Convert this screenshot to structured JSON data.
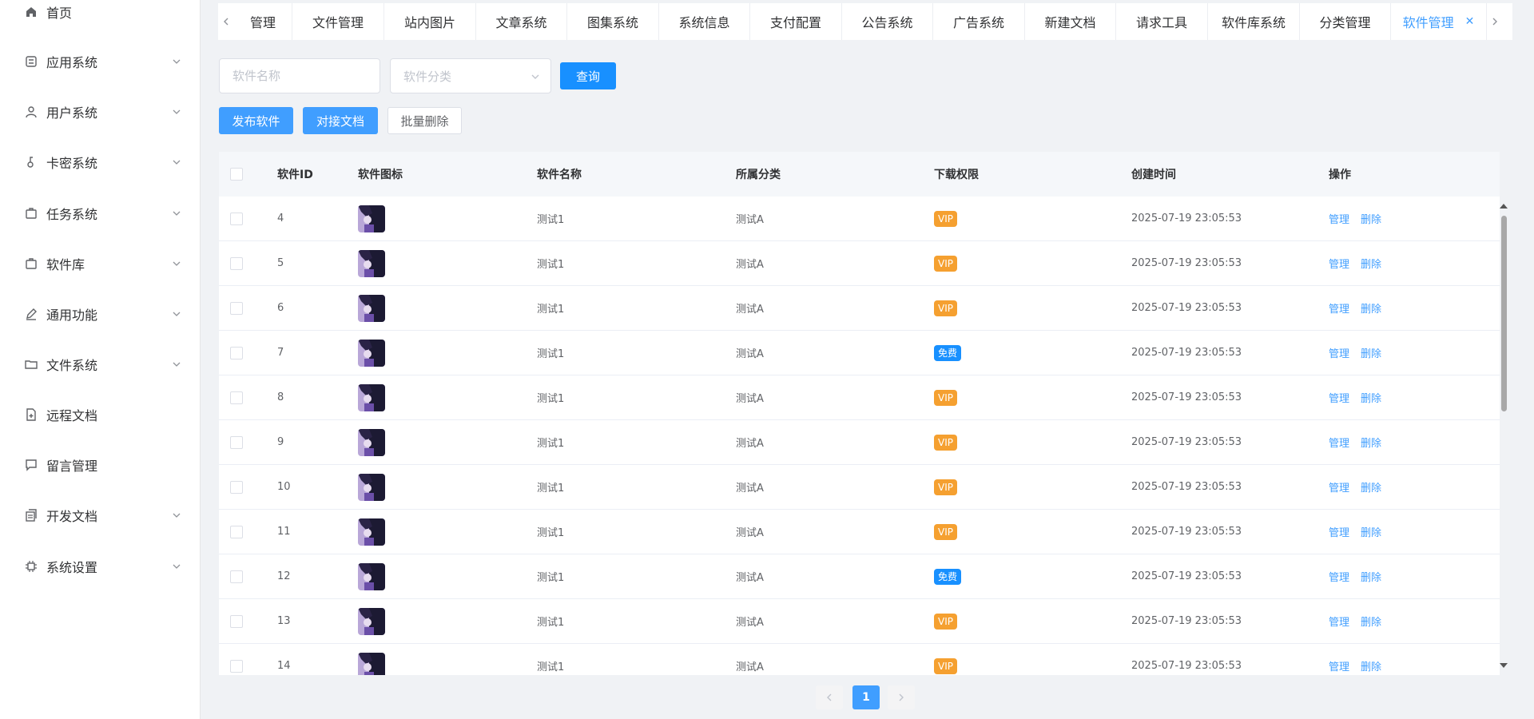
{
  "sidebar": {
    "items": [
      {
        "label": "首页",
        "icon": "home-icon",
        "expandable": false
      },
      {
        "label": "应用系统",
        "icon": "app-icon",
        "expandable": true
      },
      {
        "label": "用户系统",
        "icon": "user-icon",
        "expandable": true
      },
      {
        "label": "卡密系统",
        "icon": "key-icon",
        "expandable": true
      },
      {
        "label": "任务系统",
        "icon": "task-icon",
        "expandable": true
      },
      {
        "label": "软件库",
        "icon": "software-icon",
        "expandable": true
      },
      {
        "label": "通用功能",
        "icon": "edit-icon",
        "expandable": true
      },
      {
        "label": "文件系统",
        "icon": "folder-icon",
        "expandable": true
      },
      {
        "label": "远程文档",
        "icon": "remote-doc-icon",
        "expandable": false
      },
      {
        "label": "留言管理",
        "icon": "message-icon",
        "expandable": false
      },
      {
        "label": "开发文档",
        "icon": "dev-doc-icon",
        "expandable": true
      },
      {
        "label": "系统设置",
        "icon": "chip-icon",
        "expandable": true
      }
    ]
  },
  "tabs": [
    {
      "label": "管理",
      "active": false
    },
    {
      "label": "文件管理",
      "active": false
    },
    {
      "label": "站内图片",
      "active": false
    },
    {
      "label": "文章系统",
      "active": false
    },
    {
      "label": "图集系统",
      "active": false
    },
    {
      "label": "系统信息",
      "active": false
    },
    {
      "label": "支付配置",
      "active": false
    },
    {
      "label": "公告系统",
      "active": false
    },
    {
      "label": "广告系统",
      "active": false
    },
    {
      "label": "新建文档",
      "active": false
    },
    {
      "label": "请求工具",
      "active": false
    },
    {
      "label": "软件库系统",
      "active": false
    },
    {
      "label": "分类管理",
      "active": false
    },
    {
      "label": "软件管理",
      "active": true
    }
  ],
  "filters": {
    "name_placeholder": "软件名称",
    "category_placeholder": "软件分类",
    "query_label": "查询"
  },
  "actions": {
    "publish_label": "发布软件",
    "docs_label": "对接文档",
    "batch_delete_label": "批量删除"
  },
  "table": {
    "columns": [
      "软件ID",
      "软件图标",
      "软件名称",
      "所属分类",
      "下载权限",
      "创建时间",
      "操作"
    ],
    "rows": [
      {
        "id": "4",
        "name": "测试1",
        "category": "测试A",
        "permission": "VIP",
        "created": "2025-07-19 23:05:53"
      },
      {
        "id": "5",
        "name": "测试1",
        "category": "测试A",
        "permission": "VIP",
        "created": "2025-07-19 23:05:53"
      },
      {
        "id": "6",
        "name": "测试1",
        "category": "测试A",
        "permission": "VIP",
        "created": "2025-07-19 23:05:53"
      },
      {
        "id": "7",
        "name": "测试1",
        "category": "测试A",
        "permission": "免费",
        "created": "2025-07-19 23:05:53"
      },
      {
        "id": "8",
        "name": "测试1",
        "category": "测试A",
        "permission": "VIP",
        "created": "2025-07-19 23:05:53"
      },
      {
        "id": "9",
        "name": "测试1",
        "category": "测试A",
        "permission": "VIP",
        "created": "2025-07-19 23:05:53"
      },
      {
        "id": "10",
        "name": "测试1",
        "category": "测试A",
        "permission": "VIP",
        "created": "2025-07-19 23:05:53"
      },
      {
        "id": "11",
        "name": "测试1",
        "category": "测试A",
        "permission": "VIP",
        "created": "2025-07-19 23:05:53"
      },
      {
        "id": "12",
        "name": "测试1",
        "category": "测试A",
        "permission": "免费",
        "created": "2025-07-19 23:05:53"
      },
      {
        "id": "13",
        "name": "测试1",
        "category": "测试A",
        "permission": "VIP",
        "created": "2025-07-19 23:05:53"
      },
      {
        "id": "14",
        "name": "测试1",
        "category": "测试A",
        "permission": "VIP",
        "created": "2025-07-19 23:05:53"
      }
    ],
    "op_manage": "管理",
    "op_delete": "删除"
  },
  "pagination": {
    "current": "1"
  },
  "colors": {
    "primary": "#409eff",
    "vip": "#f5a030",
    "free": "#1890ff"
  }
}
